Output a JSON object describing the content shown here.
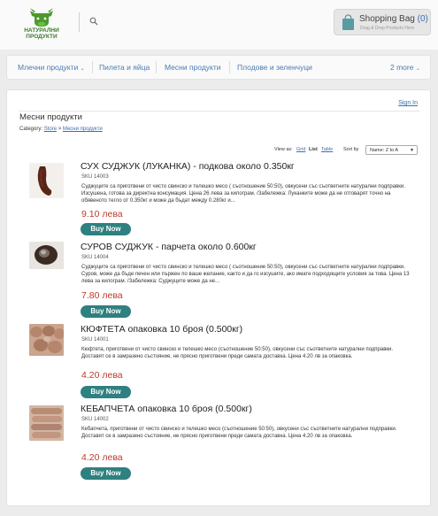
{
  "header": {
    "logo_text_line1": "НАТУРАЛНИ",
    "logo_text_line2": "ПРОДУКТИ",
    "bag_title": "Shopping Bag",
    "bag_count": "(0)",
    "bag_subtitle": "Drag & Drop Products Here"
  },
  "nav": {
    "items": [
      {
        "label": "Млечни продукти",
        "has_dropdown": true
      },
      {
        "label": "Пилета и яйца",
        "has_dropdown": false
      },
      {
        "label": "Месни продукти",
        "has_dropdown": false
      },
      {
        "label": "Плодове и зеленчуци",
        "has_dropdown": false
      }
    ],
    "more_label": "2 more"
  },
  "main": {
    "signin": "Sign In",
    "page_title": "Месни продукти",
    "breadcrumb": {
      "prefix": "Category:",
      "root": "Store",
      "sep": ">",
      "current": "Месни продукти"
    },
    "view": {
      "label": "View as:",
      "grid": "Grid",
      "list": "List",
      "table": "Table",
      "sort_label": "Sort by",
      "sort_value": "Name: Z to A"
    }
  },
  "products": [
    {
      "name": "СУХ СУДЖУК (ЛУКАНКА) - подкова около 0.350кг",
      "sku": "SKU 14003",
      "desc": "Суджуците са приготвени от чисто свинско и телешко месо ( съотношение 50:50), овкусени със съответните натурални подправки. Изсушена, готова за директна консумация. Цена 26 лева за килограм. /Забележка: Луканките може да не отговарят точно на обявеното тегло от 0.350кг и може да бъдат между 0.280кг и...",
      "price": "9.10 лева",
      "button": "Buy Now"
    },
    {
      "name": "СУРОВ СУДЖУК - парчета около 0.600кг",
      "sku": "SKU 14004",
      "desc": "Суджуците са приготвени от чисто свинско и телешко месо ( съотношение 50:50), овкусени със съответните натурални подправки. Суров, може да бъде печен или пържен по ваше желание, както и да го изсушите, ако имате подходящите условия за това. Цена 13 лева за килограм. /Забележка: Суджуците може да не...",
      "price": "7.80 лева",
      "button": "Buy Now"
    },
    {
      "name": "КЮФТЕТА опаковка 10 броя (0.500кг)",
      "sku": "SKU 14001",
      "desc": "Кюфтета, приготвени от чисто свинско и телешко месо (съотношение 50:50), овкусени със съответните натурални подправки. Доставят се в замразено състояние, не прясно приготвени преди самата доставка. Цена 4.20 лв за опаковка.",
      "price": "4.20 лева",
      "button": "Buy Now"
    },
    {
      "name": "КЕБАПЧЕТА опаковка 10 броя (0.500кг)",
      "sku": "SKU 14002",
      "desc": "Кебапчета, приготвени от чисто свинско и телешко месо (съотношение 50:50), овкусени със съответните натурални подправки. Доставят се в замразено състояние, не прясно приготвени преди самата доставка. Цена 4.20 лв за опаковка.",
      "price": "4.20 лева",
      "button": "Buy Now"
    }
  ]
}
